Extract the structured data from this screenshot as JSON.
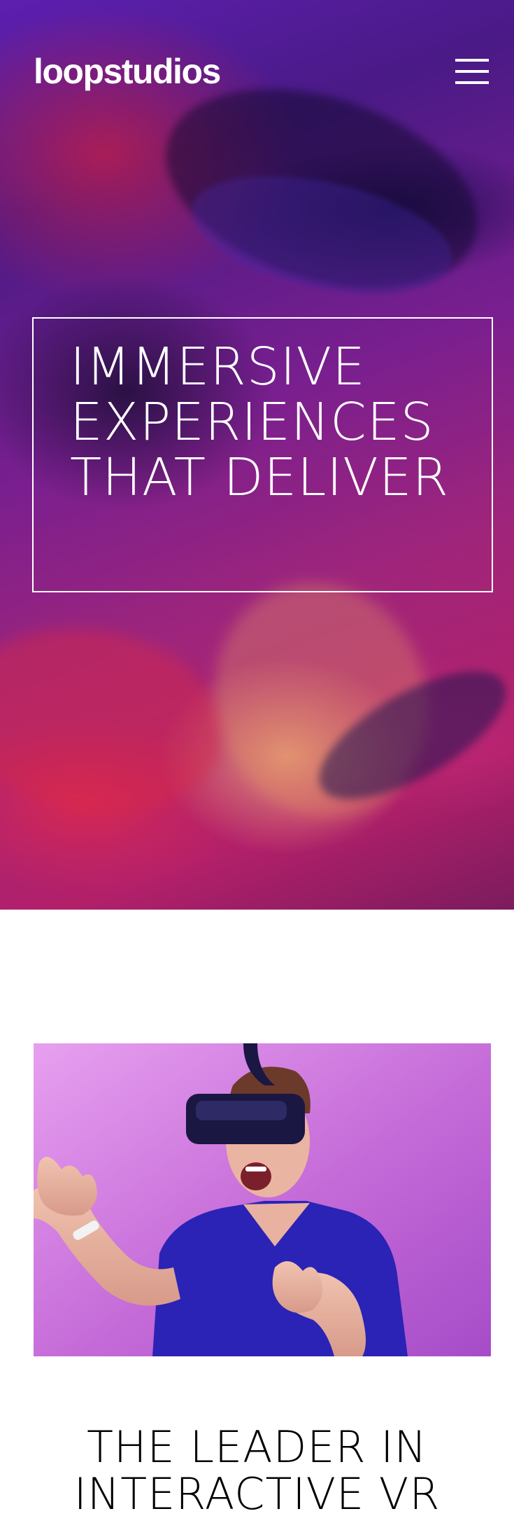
{
  "header": {
    "logo_text": "loopstudios",
    "menu_icon": "hamburger-menu-icon"
  },
  "hero": {
    "headline": "Immersive experiences that deliver"
  },
  "interactive": {
    "image_subject": "man-wearing-vr-headset",
    "title": "The leader in interactive VR"
  },
  "colors": {
    "text_light": "#ffffff",
    "text_dark": "#000000",
    "photo_background": "#c46ad8",
    "shirt": "#2a23b5"
  }
}
